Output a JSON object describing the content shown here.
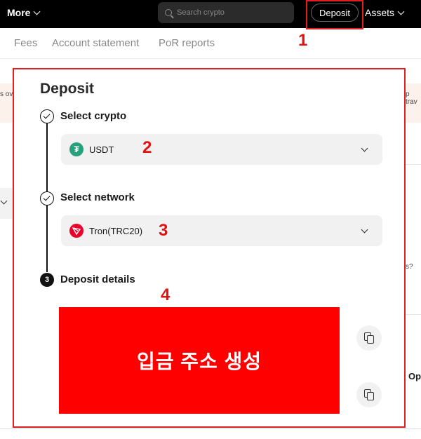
{
  "header": {
    "more_label": "More",
    "search_placeholder": "Search crypto",
    "deposit_label": "Deposit",
    "assets_label": "Assets"
  },
  "subnav": {
    "items": [
      "Fees",
      "Account statement",
      "PoR reports"
    ]
  },
  "background_fragments": {
    "left_top": "s ov",
    "right_top": "p trav",
    "right_mid": "s?",
    "right_bottom": "Op"
  },
  "deposit_panel": {
    "title": "Deposit",
    "step1": {
      "label": "Select crypto",
      "value": "USDT",
      "coin_symbol": "₮"
    },
    "step2": {
      "label": "Select network",
      "value": "Tron(TRC20)"
    },
    "step3": {
      "number": "3",
      "label": "Deposit details"
    },
    "red_block_text": "입금 주소 생성"
  },
  "annotations": [
    "1",
    "2",
    "3",
    "4"
  ],
  "colors": {
    "annotation_red": "#e51010",
    "usdt_green": "#26a17b",
    "tron_red": "#eb0029"
  }
}
